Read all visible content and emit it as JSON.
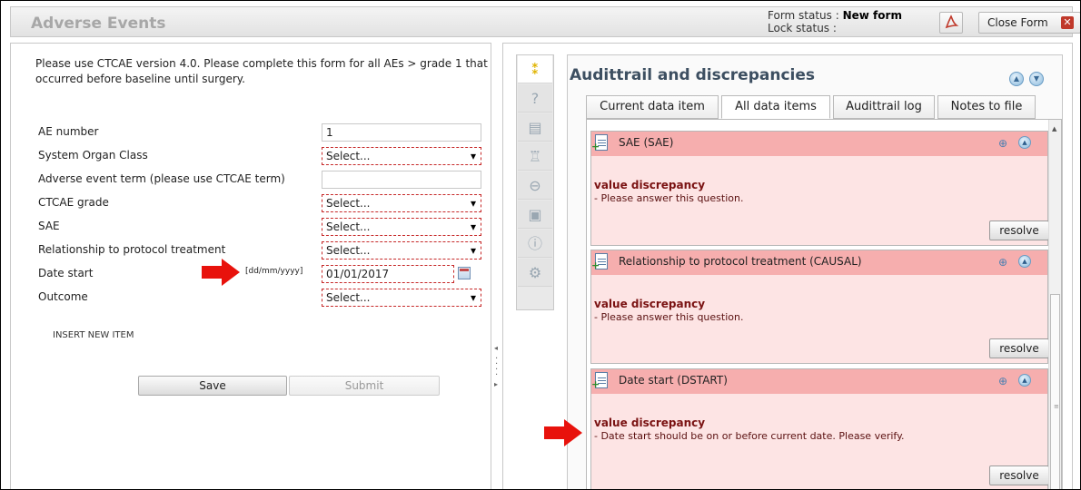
{
  "app": {
    "title": "Adverse Events"
  },
  "status": {
    "form_label": "Form status :",
    "form_value": "New form",
    "lock_label": "Lock status :",
    "lock_value": ""
  },
  "header": {
    "close_label": "Close Form",
    "close_icon": "close-icon",
    "pdf_icon": "pdf-icon"
  },
  "form": {
    "intro": "Please use CTCAE version 4.0. Please complete this form for all AEs > grade 1 that occurred before baseline until surgery.",
    "fields": [
      {
        "label": "AE number",
        "value": "1"
      },
      {
        "label": "System Organ Class",
        "value": "Select..."
      },
      {
        "label": "Adverse event term (please use CTCAE term)",
        "value": ""
      },
      {
        "label": "CTCAE grade",
        "value": "Select..."
      },
      {
        "label": "SAE",
        "value": "Select..."
      },
      {
        "label": "Relationship to protocol treatment",
        "value": "Select..."
      },
      {
        "label": "Date start",
        "value": "01/01/2017",
        "format": "[dd/mm/yyyy]"
      },
      {
        "label": "Outcome",
        "value": "Select..."
      }
    ],
    "insert_label": "INSERT NEW ITEM",
    "save_label": "Save",
    "submit_label": "Submit"
  },
  "audit": {
    "title": "Audittrail and discrepancies",
    "tabs": [
      "Current data item",
      "All data items",
      "Audittrail log",
      "Notes to file"
    ],
    "active_tab": "All data items",
    "cards": [
      {
        "title": "SAE (SAE)",
        "type": "value discrepancy",
        "message": "- Please answer this question.",
        "action": "resolve"
      },
      {
        "title": "Relationship to protocol treatment (CAUSAL)",
        "type": "value discrepancy",
        "message": "- Please answer this question.",
        "action": "resolve"
      },
      {
        "title": "Date start (DSTART)",
        "type": "value discrepancy",
        "message": "- Date start should be on or before current date. Please verify.",
        "action": "resolve"
      }
    ]
  },
  "side_icons": [
    "footprints-icon",
    "question-icon",
    "document-icon",
    "body-icon",
    "lock-icon",
    "clipboard-icon",
    "info-icon",
    "settings-icon"
  ],
  "colors": {
    "error_border": "#c62828",
    "card_header": "#f6aeae",
    "card_body": "#fde4e4",
    "annotation_arrow": "#e8120c",
    "discrepancy_text": "#7a1212"
  }
}
